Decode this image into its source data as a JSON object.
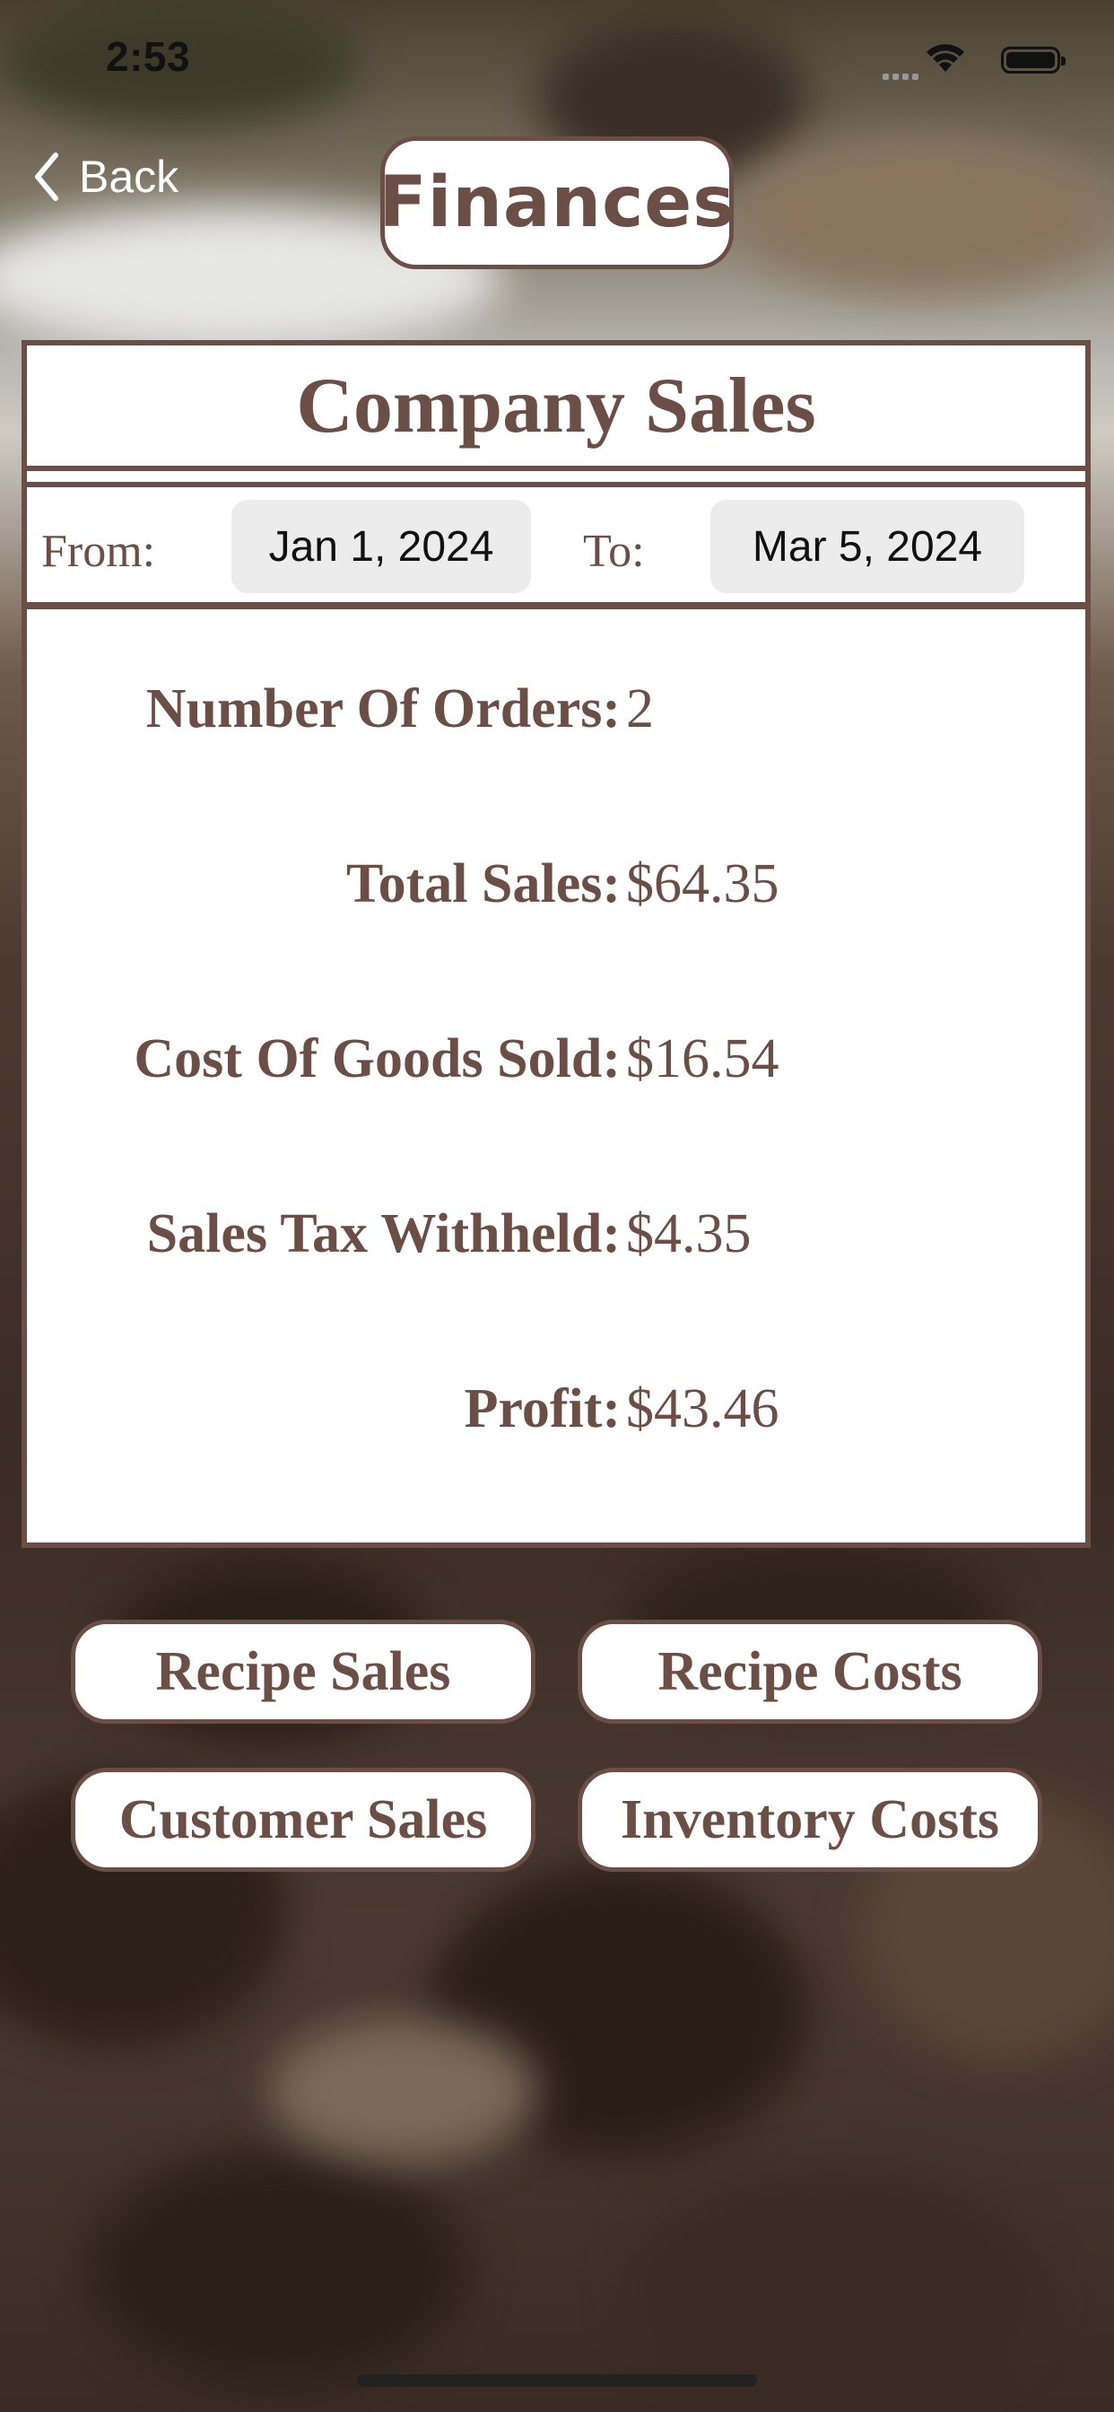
{
  "status_bar": {
    "time": "2:53"
  },
  "nav": {
    "back_label": "Back",
    "title": "Finances"
  },
  "panel": {
    "header": "Company Sales",
    "from_label": "From:",
    "from_date": "Jan 1, 2024",
    "to_label": "To:",
    "to_date": "Mar 5, 2024"
  },
  "stats": [
    {
      "label": "Number Of Orders:",
      "value": "2"
    },
    {
      "label": "Total Sales:",
      "value": "$64.35"
    },
    {
      "label": "Cost Of Goods Sold:",
      "value": "$16.54"
    },
    {
      "label": "Sales Tax Withheld:",
      "value": "$4.35"
    },
    {
      "label": "Profit:",
      "value": "$43.46"
    }
  ],
  "buttons": {
    "recipe_sales": "Recipe Sales",
    "recipe_costs": "Recipe Costs",
    "customer_sales": "Customer Sales",
    "inventory_costs": "Inventory Costs"
  },
  "colors": {
    "accent": "#6b4f47",
    "chip_bg": "#ececec"
  }
}
